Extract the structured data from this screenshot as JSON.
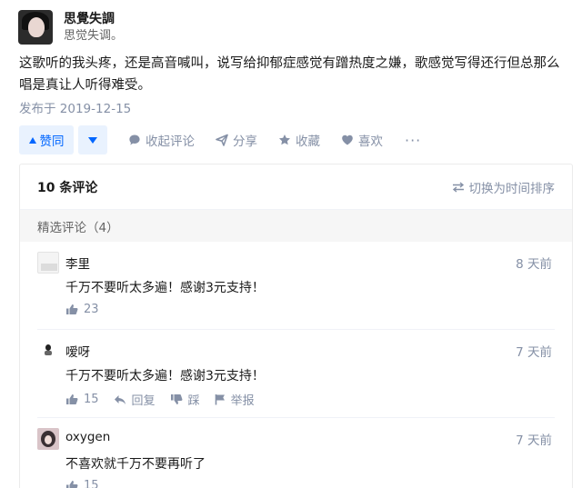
{
  "author": {
    "name": "思覺失調",
    "bio": "思觉失调。"
  },
  "answer": {
    "text": "这歌听的我头疼，还是高音喊叫，说写给抑郁症感觉有蹭热度之嫌，歌感觉写得还行但总那么唱是真让人听得难受。",
    "published": "发布于 2019-12-15"
  },
  "actions": {
    "upvote": "赞同",
    "collapse_comments": "收起评论",
    "share": "分享",
    "favorite": "收藏",
    "like": "喜欢",
    "more": "···"
  },
  "comments": {
    "count_label": "10 条评论",
    "sort_label": "切换为时间排序",
    "featured_label": "精选评论（4）",
    "items": [
      {
        "name": "李里",
        "time": "8 天前",
        "text": "千万不要听太多遍！感谢3元支持！",
        "likes": "23",
        "reply": "",
        "dislike": "",
        "report": ""
      },
      {
        "name": "嗳呀",
        "time": "7 天前",
        "text": "千万不要听太多遍！感谢3元支持！",
        "likes": "15",
        "reply": "回复",
        "dislike": "踩",
        "report": "举报"
      },
      {
        "name": "oxygen",
        "time": "7 天前",
        "text": "不喜欢就千万不要再听了",
        "likes": "15",
        "reply": "",
        "dislike": "",
        "report": ""
      }
    ]
  },
  "colors": {
    "accent": "#0066ff",
    "accent_bg": "#e9f2fe",
    "muted": "#8590a6"
  },
  "icons": [
    "comment-icon",
    "share-icon",
    "star-icon",
    "heart-icon",
    "sort-icon",
    "thumb-up-icon",
    "reply-icon",
    "thumb-down-icon",
    "flag-icon"
  ]
}
